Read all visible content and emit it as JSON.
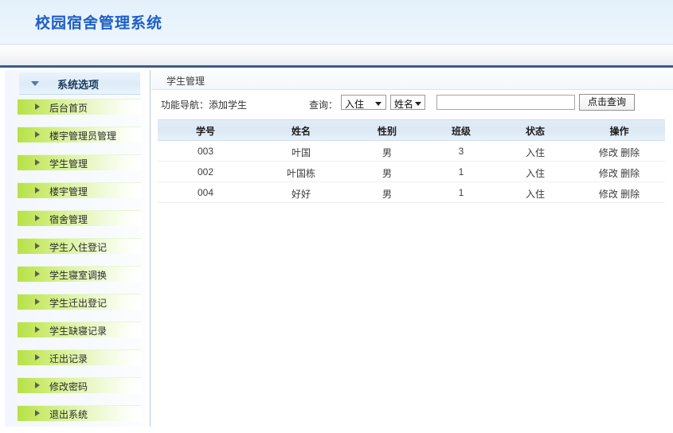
{
  "app": {
    "title": "校园宿舍管理系统"
  },
  "sidebar": {
    "panel_title": "系统选项",
    "caret_icon": "chevron-down-icon",
    "items": [
      {
        "label": "后台首页",
        "icon": "arrow-right-icon"
      },
      {
        "label": "楼宇管理员管理",
        "icon": "arrow-right-icon"
      },
      {
        "label": "学生管理",
        "icon": "arrow-right-icon"
      },
      {
        "label": "楼宇管理",
        "icon": "arrow-right-icon"
      },
      {
        "label": "宿舍管理",
        "icon": "arrow-right-icon"
      },
      {
        "label": "学生入住登记",
        "icon": "arrow-right-icon"
      },
      {
        "label": "学生寝室调换",
        "icon": "arrow-right-icon"
      },
      {
        "label": "学生迁出登记",
        "icon": "arrow-right-icon"
      },
      {
        "label": "学生缺寝记录",
        "icon": "arrow-right-icon"
      },
      {
        "label": "迁出记录",
        "icon": "arrow-right-icon"
      },
      {
        "label": "修改密码",
        "icon": "arrow-right-icon"
      },
      {
        "label": "退出系统",
        "icon": "arrow-right-icon"
      }
    ]
  },
  "content": {
    "tab_label": "学生管理",
    "toolbar": {
      "func_nav": "功能导航：添加学生",
      "query_label": "查询：",
      "status_select": {
        "value": "入住",
        "caret_icon": "chevron-down-icon"
      },
      "field_select": {
        "value": "姓名",
        "caret_icon": "chevron-down-icon"
      },
      "search_value": "",
      "search_placeholder": "",
      "search_button": "点击查询"
    },
    "table": {
      "headers": [
        "学号",
        "姓名",
        "性别",
        "班级",
        "状态",
        "操作"
      ],
      "rows": [
        {
          "id": "003",
          "name": "叶国",
          "gender": "男",
          "class": "3",
          "status": "入住",
          "edit": "修改",
          "delete": "删除"
        },
        {
          "id": "002",
          "name": "叶国栋",
          "gender": "男",
          "class": "1",
          "status": "入住",
          "edit": "修改",
          "delete": "删除"
        },
        {
          "id": "004",
          "name": "好好",
          "gender": "男",
          "class": "1",
          "status": "入住",
          "edit": "修改",
          "delete": "删除"
        }
      ]
    }
  },
  "colors": {
    "title_blue": "#1d5fc4",
    "nav_border": "#3c5d86",
    "menu_green": "#b7e148",
    "table_header": "#dbe8f4"
  }
}
